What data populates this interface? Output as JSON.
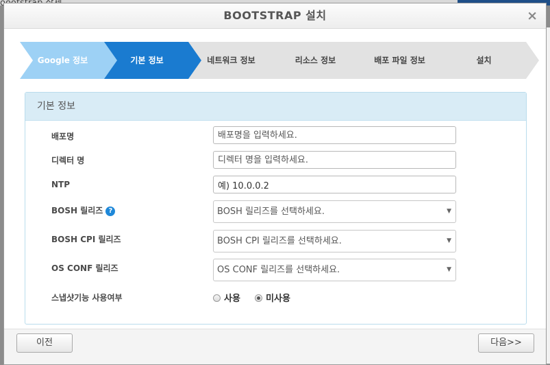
{
  "background": {
    "text": "oootstrap 삭제"
  },
  "dialog": {
    "title": "BOOTSTRAP 설치",
    "close_label": "×"
  },
  "wizard": {
    "steps": [
      {
        "label": "Google 정보",
        "state": "done"
      },
      {
        "label": "기본 정보",
        "state": "active"
      },
      {
        "label": "네트워크 정보",
        "state": "pending"
      },
      {
        "label": "리소스 정보",
        "state": "pending"
      },
      {
        "label": "배포 파일 정보",
        "state": "pending"
      },
      {
        "label": "설치",
        "state": "pending"
      }
    ],
    "colors": {
      "done": "#9dd1f5",
      "active": "#1a7bd0",
      "pending": "#e2e2e2",
      "done_text": "#ffffff",
      "active_text": "#ffffff",
      "pending_text": "#444444"
    }
  },
  "panel": {
    "title": "기본 정보",
    "fields": [
      {
        "label": "배포명",
        "placeholder": "배포명을 입력하세요.",
        "value": ""
      },
      {
        "label": "디렉터 명",
        "placeholder": "디렉터 명을 입력하세요.",
        "value": ""
      },
      {
        "label": "NTP",
        "placeholder": "",
        "value": "예) 10.0.0.2"
      }
    ],
    "selects": [
      {
        "label": "BOSH 릴리즈",
        "selected": "BOSH 릴리즈를 선택하세요.",
        "has_help": true
      },
      {
        "label": "BOSH CPI 릴리즈",
        "selected": "BOSH CPI 릴리즈를 선택하세요.",
        "has_help": false
      },
      {
        "label": "OS CONF 릴리즈",
        "selected": "OS CONF 릴리즈를 선택하세요.",
        "has_help": false
      }
    ],
    "help_icon": "?",
    "snapshot": {
      "label": "스냅샷기능 사용여부",
      "options": [
        {
          "label": "사용",
          "checked": false
        },
        {
          "label": "미사용",
          "checked": true
        }
      ]
    }
  },
  "footer": {
    "prev_label": "이전",
    "next_label": "다음>>"
  },
  "icons": {
    "select_arrow": "▼"
  }
}
